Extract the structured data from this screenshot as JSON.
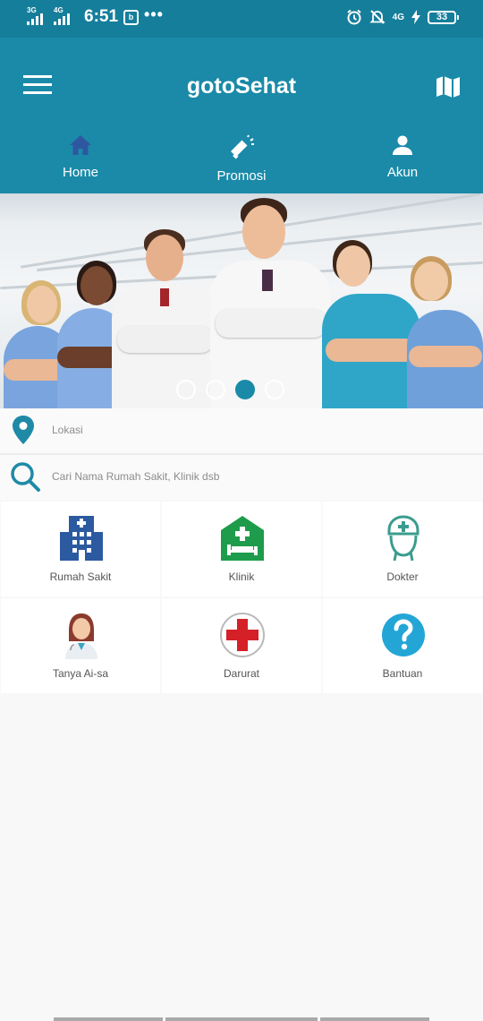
{
  "status_bar": {
    "network_1": "3G",
    "network_2": "4G",
    "time": "6:51",
    "notification_dots": "•••",
    "volte": "4G",
    "battery": "33"
  },
  "app_bar": {
    "title": "gotoSehat",
    "menu_icon": "hamburger-icon",
    "map_icon": "map-icon"
  },
  "nav_tabs": [
    {
      "label": "Home",
      "icon": "home-icon"
    },
    {
      "label": "Promosi",
      "icon": "megaphone-icon"
    },
    {
      "label": "Akun",
      "icon": "person-icon"
    }
  ],
  "banner": {
    "slide_count": 4,
    "active_slide_index": 2
  },
  "search": {
    "location_placeholder": "Lokasi",
    "search_placeholder": "Cari Nama Rumah Sakit, Klinik dsb"
  },
  "menu_grid": [
    {
      "label": "Rumah Sakit",
      "icon": "hospital-building-icon"
    },
    {
      "label": "Klinik",
      "icon": "clinic-bed-icon"
    },
    {
      "label": "Dokter",
      "icon": "doctor-nurse-icon"
    },
    {
      "label": "Tanya Ai-sa",
      "icon": "assistant-avatar-icon"
    },
    {
      "label": "Darurat",
      "icon": "red-cross-icon"
    },
    {
      "label": "Bantuan",
      "icon": "help-question-icon"
    }
  ],
  "colors": {
    "status_bar": "#157e9b",
    "app_bar": "#1a8aa8",
    "nav_icon_blue": "#2f57a0",
    "grid_bg": "#ffffff",
    "placeholder_text": "#8c8c8c"
  }
}
